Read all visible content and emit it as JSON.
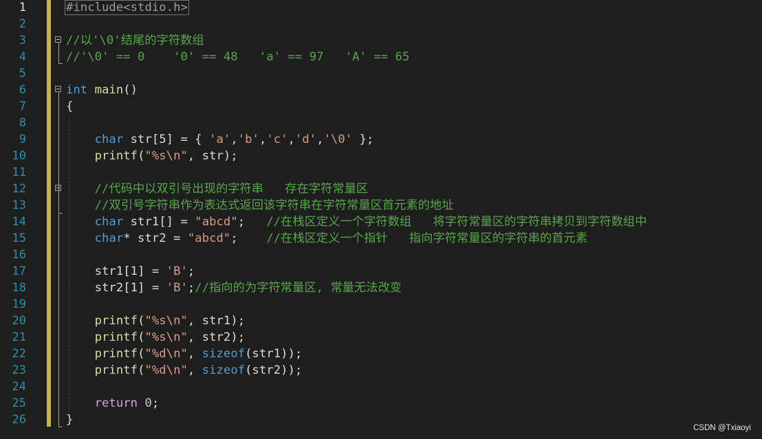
{
  "editor": {
    "line_numbers": [
      "1",
      "2",
      "3",
      "4",
      "5",
      "6",
      "7",
      "8",
      "9",
      "10",
      "11",
      "12",
      "13",
      "14",
      "15",
      "16",
      "17",
      "18",
      "19",
      "20",
      "21",
      "22",
      "23",
      "24",
      "25",
      "26"
    ],
    "lines": [
      {
        "tokens": [
          {
            "t": "#include<stdio.h>",
            "c": "pp",
            "box": true
          }
        ]
      },
      {
        "tokens": []
      },
      {
        "tokens": [
          {
            "t": "//以'\\0'结尾的字符数组",
            "c": "cmt"
          }
        ]
      },
      {
        "tokens": [
          {
            "t": "//'\\0' == 0    '0' == 48   'a' == 97   'A' == 65",
            "c": "cmt"
          }
        ]
      },
      {
        "tokens": []
      },
      {
        "tokens": [
          {
            "t": "int",
            "c": "kw"
          },
          {
            "t": " "
          },
          {
            "t": "main",
            "c": "fn"
          },
          {
            "t": "()"
          }
        ]
      },
      {
        "tokens": [
          {
            "t": "{"
          }
        ]
      },
      {
        "tokens": []
      },
      {
        "tokens": [
          {
            "t": "    "
          },
          {
            "t": "char",
            "c": "kw"
          },
          {
            "t": " str[5] = { "
          },
          {
            "t": "'a'",
            "c": "str"
          },
          {
            "t": ","
          },
          {
            "t": "'b'",
            "c": "str"
          },
          {
            "t": ","
          },
          {
            "t": "'c'",
            "c": "str"
          },
          {
            "t": ","
          },
          {
            "t": "'d'",
            "c": "str"
          },
          {
            "t": ","
          },
          {
            "t": "'\\0'",
            "c": "str"
          },
          {
            "t": " };"
          }
        ]
      },
      {
        "tokens": [
          {
            "t": "    "
          },
          {
            "t": "printf",
            "c": "fn"
          },
          {
            "t": "("
          },
          {
            "t": "\"%s\\n\"",
            "c": "str"
          },
          {
            "t": ", str);"
          }
        ]
      },
      {
        "tokens": []
      },
      {
        "tokens": [
          {
            "t": "    "
          },
          {
            "t": "//代码中以双引号出现的字符串   存在字符常量区",
            "c": "cmt"
          }
        ]
      },
      {
        "tokens": [
          {
            "t": "    "
          },
          {
            "t": "//双引号字符串作为表达式返回该字符串在字符常量区首元素的地址",
            "c": "cmt"
          }
        ]
      },
      {
        "tokens": [
          {
            "t": "    "
          },
          {
            "t": "char",
            "c": "kw"
          },
          {
            "t": " str1[] = "
          },
          {
            "t": "\"abcd\"",
            "c": "str"
          },
          {
            "t": ";   "
          },
          {
            "t": "//在栈区定义一个字符数组   将字符常量区的字符串拷贝到字符数组中",
            "c": "cmt"
          }
        ]
      },
      {
        "tokens": [
          {
            "t": "    "
          },
          {
            "t": "char",
            "c": "kw"
          },
          {
            "t": "* str2 = "
          },
          {
            "t": "\"abcd\"",
            "c": "str"
          },
          {
            "t": ";    "
          },
          {
            "t": "//在栈区定义一个指针   指向字符常量区的字符串的首元素",
            "c": "cmt"
          }
        ]
      },
      {
        "tokens": []
      },
      {
        "tokens": [
          {
            "t": "    str1[1] = "
          },
          {
            "t": "'B'",
            "c": "str"
          },
          {
            "t": ";"
          }
        ]
      },
      {
        "tokens": [
          {
            "t": "    str2[1] = "
          },
          {
            "t": "'B'",
            "c": "str"
          },
          {
            "t": ";"
          },
          {
            "t": "//指向的为字符常量区, 常量无法改变",
            "c": "cmt"
          }
        ]
      },
      {
        "tokens": []
      },
      {
        "tokens": [
          {
            "t": "    "
          },
          {
            "t": "printf",
            "c": "fn"
          },
          {
            "t": "("
          },
          {
            "t": "\"%s\\n\"",
            "c": "str"
          },
          {
            "t": ", str1);"
          }
        ]
      },
      {
        "tokens": [
          {
            "t": "    "
          },
          {
            "t": "printf",
            "c": "fn"
          },
          {
            "t": "("
          },
          {
            "t": "\"%s\\n\"",
            "c": "str"
          },
          {
            "t": ", str2);"
          }
        ]
      },
      {
        "tokens": [
          {
            "t": "    "
          },
          {
            "t": "printf",
            "c": "fn"
          },
          {
            "t": "("
          },
          {
            "t": "\"%d\\n\"",
            "c": "str"
          },
          {
            "t": ", "
          },
          {
            "t": "sizeof",
            "c": "kw"
          },
          {
            "t": "(str1));"
          }
        ]
      },
      {
        "tokens": [
          {
            "t": "    "
          },
          {
            "t": "printf",
            "c": "fn"
          },
          {
            "t": "("
          },
          {
            "t": "\"%d\\n\"",
            "c": "str"
          },
          {
            "t": ", "
          },
          {
            "t": "sizeof",
            "c": "kw"
          },
          {
            "t": "(str2));"
          }
        ]
      },
      {
        "tokens": []
      },
      {
        "tokens": [
          {
            "t": "    "
          },
          {
            "t": "return",
            "c": "ctrl"
          },
          {
            "t": " "
          },
          {
            "t": "0",
            "c": "num"
          },
          {
            "t": ";"
          }
        ]
      },
      {
        "tokens": [
          {
            "t": "}"
          }
        ]
      }
    ]
  },
  "watermark": "CSDN @Txiaoyi",
  "colors": {
    "background": "#1e1e1e",
    "keyword": "#569cd6",
    "comment": "#57a64a",
    "string": "#d69d85",
    "line_number": "#2b91af"
  }
}
